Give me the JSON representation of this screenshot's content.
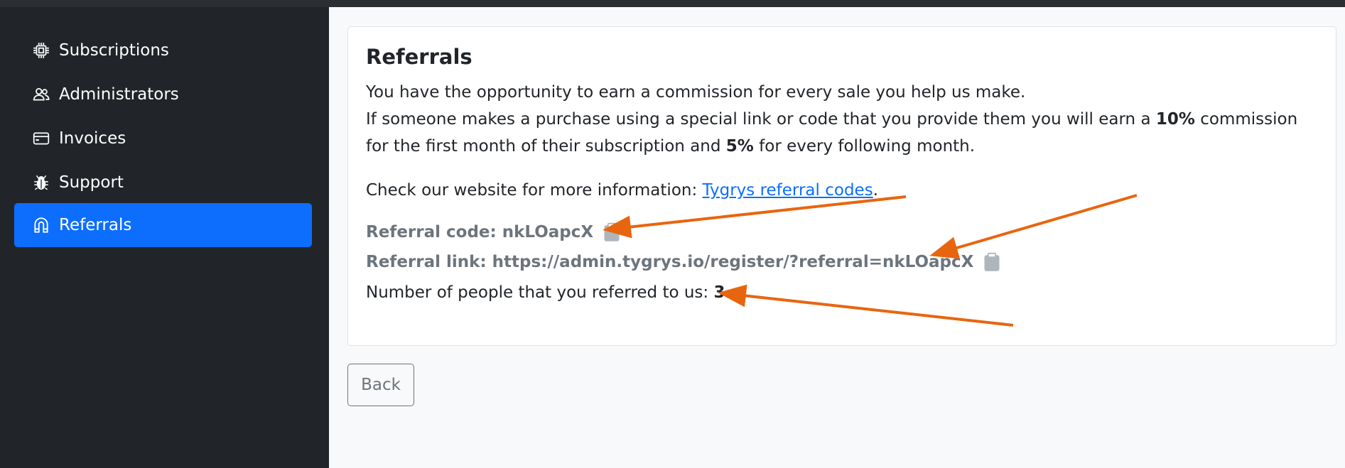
{
  "sidebar": {
    "items": [
      {
        "label": "Subscriptions",
        "icon": "chip-icon",
        "active": false
      },
      {
        "label": "Administrators",
        "icon": "people-icon",
        "active": false
      },
      {
        "label": "Invoices",
        "icon": "credit-card-icon",
        "active": false
      },
      {
        "label": "Support",
        "icon": "bug-icon",
        "active": false
      },
      {
        "label": "Referrals",
        "icon": "magnet-icon",
        "active": true
      }
    ]
  },
  "card": {
    "title": "Referrals",
    "intro_line": "You have the opportunity to earn a commission for every sale you help us make.",
    "commission_prefix": "If someone makes a purchase using a special link or code that you provide them you will earn a ",
    "first_rate": "10%",
    "commission_middle": " commission for the first month of their subscription and ",
    "following_rate": "5%",
    "commission_suffix": " for every following month.",
    "info_prefix": "Check our website for more information: ",
    "info_link": "Tygrys referral codes",
    "info_suffix": ".",
    "referral_code_label": "Referral code: nkLOapcX",
    "referral_link_label": "Referral link: https://admin.tygrys.io/register/?referral=nkLOapcX",
    "count_label": "Number of people that you referred to us: ",
    "count_value": "3"
  },
  "back_label": "Back",
  "colors": {
    "sidebar_bg": "#212529",
    "active_bg": "#0d6efd",
    "link": "#0d6efd",
    "muted": "#6c757d",
    "annotation_arrow": "#e8650f"
  }
}
